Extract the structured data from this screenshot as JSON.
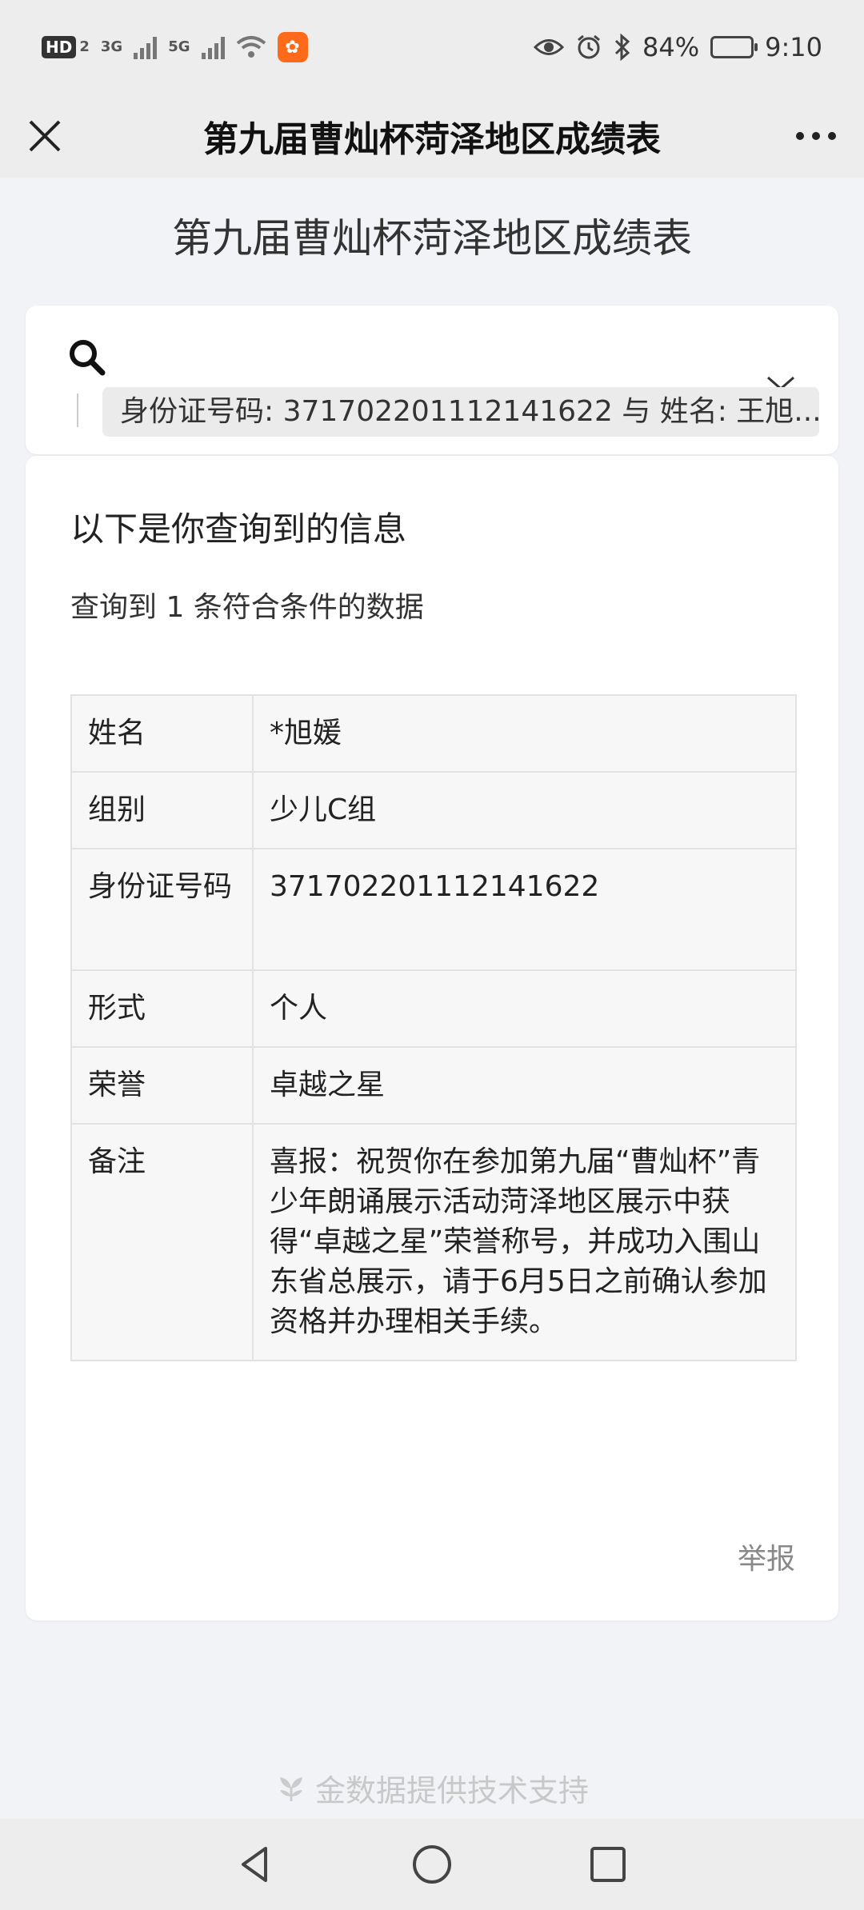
{
  "status_bar": {
    "hd_label": "HD",
    "hd_sub": "2",
    "net1": "3G",
    "net2": "5G",
    "battery_percent": "84%",
    "battery_level": 0.84,
    "time": "9:10"
  },
  "title_bar": {
    "title": "第九届曹灿杯菏泽地区成绩表"
  },
  "page": {
    "heading": "第九届曹灿杯菏泽地区成绩表"
  },
  "search": {
    "query": "身份证号码: 371702201112141622 与 姓名: 王旭..."
  },
  "result": {
    "title": "以下是你查询到的信息",
    "count_text": "查询到 1 条符合条件的数据",
    "rows": [
      {
        "key": "姓名",
        "value": "*旭媛"
      },
      {
        "key": "组别",
        "value": "少儿C组"
      },
      {
        "key": "身份证号码",
        "value": "371702201112141622"
      },
      {
        "key": "形式",
        "value": "个人"
      },
      {
        "key": "荣誉",
        "value": "卓越之星"
      },
      {
        "key": "备注",
        "value": "喜报：祝贺你在参加第九届“曹灿杯”青少年朗诵展示活动菏泽地区展示中获得“卓越之星”荣誉称号，并成功入围山东省总展示，请于6月5日之前确认参加资格并办理相关手续。"
      }
    ],
    "report_label": "举报"
  },
  "footer": {
    "powered_by": "金数据提供技术支持"
  }
}
